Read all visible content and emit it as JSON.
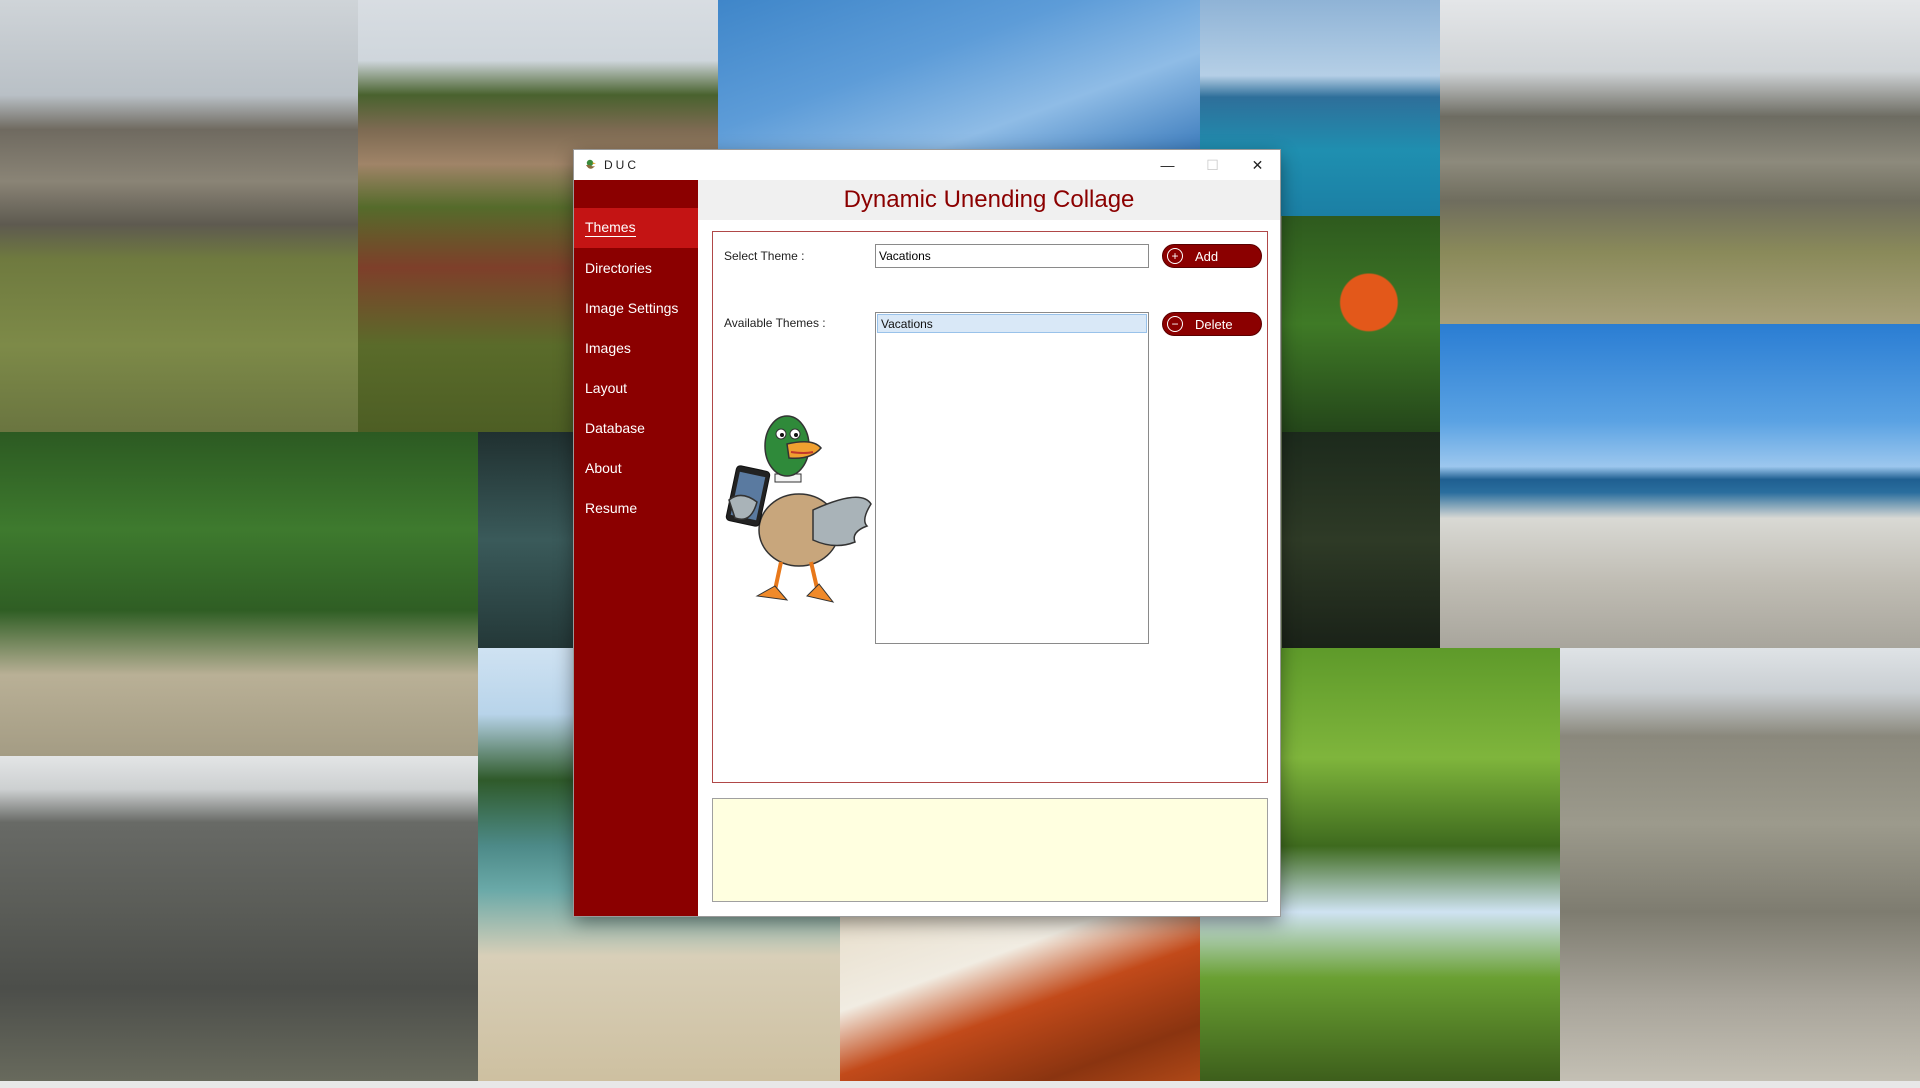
{
  "window": {
    "title": "DUC",
    "controls": {
      "minimize": "—",
      "maximize": "☐",
      "close": "✕"
    }
  },
  "header": {
    "title": "Dynamic Unending Collage"
  },
  "sidebar": {
    "items": [
      {
        "label": "Themes",
        "active": true
      },
      {
        "label": "Directories",
        "active": false
      },
      {
        "label": "Image Settings",
        "active": false
      },
      {
        "label": "Images",
        "active": false
      },
      {
        "label": "Layout",
        "active": false
      },
      {
        "label": "Database",
        "active": false
      },
      {
        "label": "About",
        "active": false
      },
      {
        "label": "Resume",
        "active": false
      }
    ]
  },
  "themes_panel": {
    "select_theme_label": "Select Theme :",
    "select_theme_value": "Vacations",
    "add_label": "Add",
    "available_themes_label": "Available Themes :",
    "delete_label": "Delete",
    "themes": [
      "Vacations"
    ]
  },
  "message_box": {
    "text": ""
  },
  "colors": {
    "sidebar": "#8b0000",
    "sidebar_active": "#c41414",
    "header_text": "#8b0000",
    "message_bg": "#ffffe0"
  },
  "icons": {
    "app": "duck-icon",
    "add": "plus-circle-icon",
    "delete": "minus-circle-icon",
    "mascot": "duck-mascot-icon"
  }
}
